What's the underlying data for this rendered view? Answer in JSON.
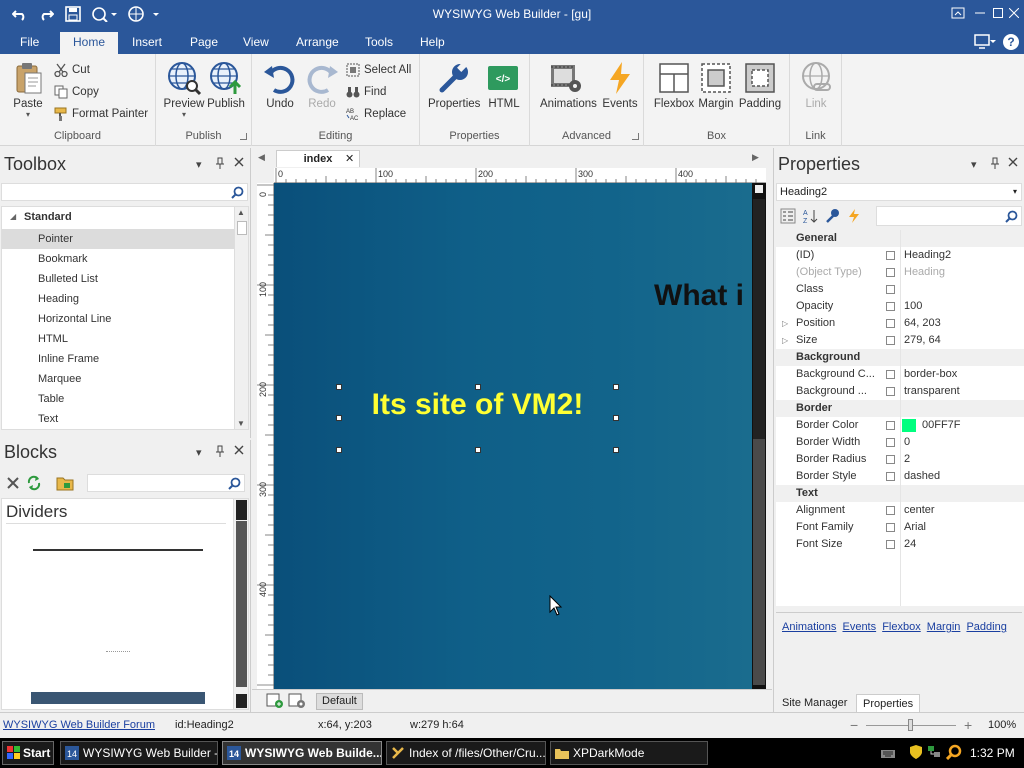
{
  "title_bar": {
    "title": "WYSIWYG Web Builder - [gu]"
  },
  "menu": {
    "file": "File",
    "home": "Home",
    "insert": "Insert",
    "page": "Page",
    "view": "View",
    "arrange": "Arrange",
    "tools": "Tools",
    "help": "Help"
  },
  "ribbon": {
    "clipboard": {
      "paste": "Paste",
      "cut": "Cut",
      "copy": "Copy",
      "format_painter": "Format Painter",
      "label": "Clipboard"
    },
    "publish": {
      "preview": "Preview",
      "publish": "Publish",
      "label": "Publish"
    },
    "editing": {
      "undo": "Undo",
      "redo": "Redo",
      "select_all": "Select All",
      "find": "Find",
      "replace": "Replace",
      "label": "Editing"
    },
    "properties": {
      "properties": "Properties",
      "html": "HTML",
      "label": "Properties"
    },
    "advanced": {
      "animations": "Animations",
      "events": "Events",
      "label": "Advanced"
    },
    "box": {
      "flexbox": "Flexbox",
      "margin": "Margin",
      "padding": "Padding",
      "label": "Box"
    },
    "link": {
      "link": "Link",
      "label": "Link"
    }
  },
  "toolbox": {
    "title": "Toolbox",
    "category": "Standard",
    "items": [
      "Pointer",
      "Bookmark",
      "Bulleted List",
      "Heading",
      "Horizontal Line",
      "HTML",
      "Inline Frame",
      "Marquee",
      "Table",
      "Text"
    ],
    "selected": "Pointer"
  },
  "blocks": {
    "title": "Blocks",
    "section": "Dividers"
  },
  "editor": {
    "doc_tab": "index",
    "ruler_h": [
      "0",
      "100",
      "200",
      "300",
      "400"
    ],
    "ruler_v": [
      "0",
      "100",
      "200",
      "300",
      "400"
    ],
    "heading_text": "Its site of VM2!",
    "partial_heading": "What i",
    "bottom_tab": "Default"
  },
  "properties": {
    "title": "Properties",
    "selected_object": "Heading2",
    "rows": [
      {
        "type": "cat",
        "name": "General"
      },
      {
        "name": "(ID)",
        "value": "Heading2"
      },
      {
        "name": "(Object Type)",
        "value": "Heading",
        "dim": true
      },
      {
        "name": "Class",
        "value": ""
      },
      {
        "name": "Opacity",
        "value": "100"
      },
      {
        "name": "Position",
        "value": "64, 203",
        "exp": true
      },
      {
        "name": "Size",
        "value": "279, 64",
        "exp": true
      },
      {
        "type": "cat",
        "name": "Background"
      },
      {
        "name": "Background C...",
        "value": "border-box"
      },
      {
        "name": "Background ...",
        "value": "transparent"
      },
      {
        "type": "cat",
        "name": "Border"
      },
      {
        "name": "Border Color",
        "value": "00FF7F",
        "swatch": "#00FF7F"
      },
      {
        "name": "Border Width",
        "value": "0"
      },
      {
        "name": "Border Radius",
        "value": "2"
      },
      {
        "name": "Border Style",
        "value": "dashed"
      },
      {
        "type": "cat",
        "name": "Text"
      },
      {
        "name": "Alignment",
        "value": "center"
      },
      {
        "name": "Font Family",
        "value": "Arial"
      },
      {
        "name": "Font Size",
        "value": "24"
      }
    ],
    "links": [
      "Animations",
      "Events",
      "Flexbox",
      "Margin",
      "Padding"
    ],
    "tabs": {
      "site_manager": "Site Manager",
      "properties": "Properties"
    }
  },
  "status_bar": {
    "forum_link": "WYSIWYG Web Builder Forum",
    "id": "id:Heading2",
    "coords": "x:64, y:203",
    "size": "w:279 h:64",
    "zoom": "100%"
  },
  "taskbar": {
    "start": "Start",
    "items": [
      "WYSIWYG Web Builder - ...",
      "WYSIWYG Web Builde...",
      "Index of /files/Other/Cru...",
      "XPDarkMode"
    ],
    "active_index": 1,
    "clock": "1:32 PM"
  },
  "colors": {
    "accent": "#2b579a",
    "heading_text": "#ffff33",
    "canvas": "#0f5f88"
  }
}
